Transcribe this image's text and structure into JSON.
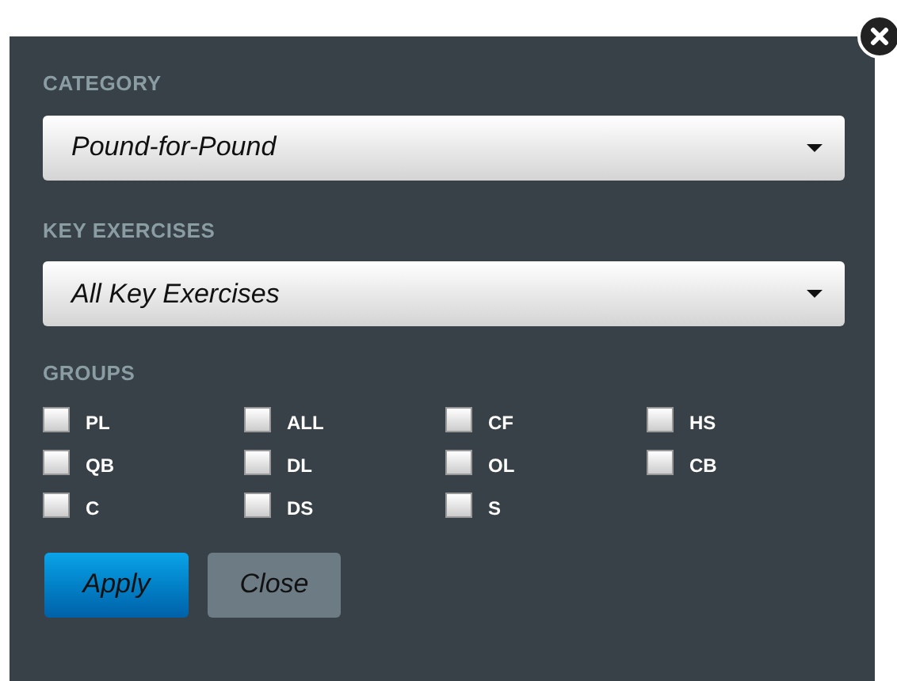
{
  "category": {
    "label": "CATEGORY",
    "value": "Pound-for-Pound"
  },
  "key_exercises": {
    "label": "KEY EXERCISES",
    "value": "All Key Exercises"
  },
  "groups": {
    "label": "GROUPS",
    "items": [
      {
        "label": "PL",
        "checked": false
      },
      {
        "label": "ALL",
        "checked": false
      },
      {
        "label": "CF",
        "checked": false
      },
      {
        "label": "HS",
        "checked": false
      },
      {
        "label": "QB",
        "checked": false
      },
      {
        "label": "DL",
        "checked": false
      },
      {
        "label": "OL",
        "checked": false
      },
      {
        "label": "CB",
        "checked": false
      },
      {
        "label": "C",
        "checked": false
      },
      {
        "label": "DS",
        "checked": false
      },
      {
        "label": "S",
        "checked": false
      }
    ]
  },
  "buttons": [
    {
      "label": "Apply",
      "kind": "primary"
    },
    {
      "label": "Close",
      "kind": "secondary"
    }
  ]
}
